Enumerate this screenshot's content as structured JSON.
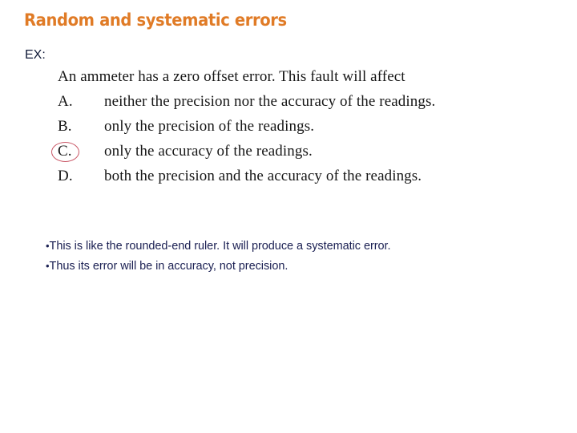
{
  "slide": {
    "title": "Random and systematic errors",
    "example_label": "EX:",
    "accent_color": "#e07b26",
    "body_text_color": "#1a1f52",
    "answer_mark_color": "#c0394b"
  },
  "question": {
    "stem": "An ammeter has a zero offset error. This fault will affect",
    "options": [
      {
        "label": "A.",
        "text": "neither the precision nor the accuracy of the readings.",
        "marked": false
      },
      {
        "label": "B.",
        "text": "only the precision of the readings.",
        "marked": false
      },
      {
        "label": "C.",
        "text": "only the accuracy of the readings.",
        "marked": true
      },
      {
        "label": "D.",
        "text": "both the precision and the accuracy of the readings.",
        "marked": false
      }
    ]
  },
  "notes": {
    "bullet_glyph": "•",
    "lines": [
      "This is like the rounded-end ruler. It will produce a systematic error.",
      "Thus its error will be in accuracy, not precision."
    ]
  }
}
